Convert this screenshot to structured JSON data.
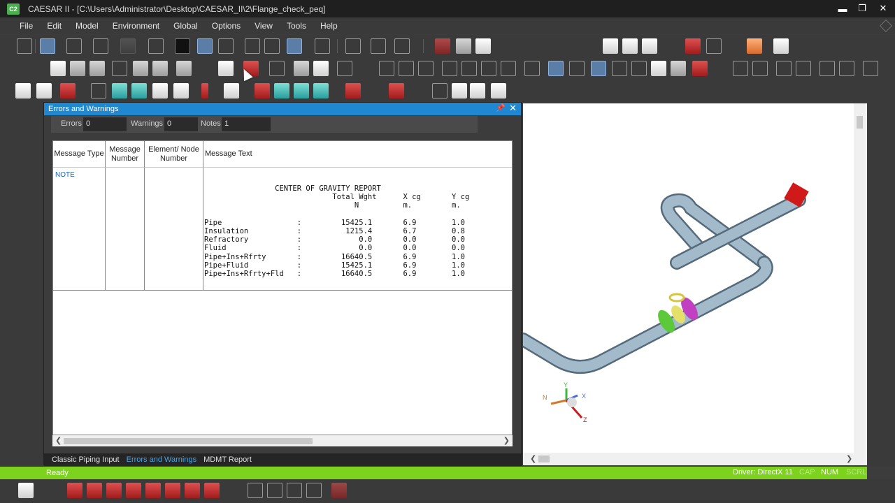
{
  "window": {
    "app_badge": "C2",
    "title": "CAESAR II - [C:\\Users\\Administrator\\Desktop\\CAESAR_II\\2\\Flange_check_peq]",
    "minimize": "▬",
    "maximize": "❐",
    "close": "✕"
  },
  "menu": [
    "File",
    "Edit",
    "Model",
    "Environment",
    "Global",
    "Options",
    "View",
    "Tools",
    "Help"
  ],
  "panel": {
    "title": "Errors and Warnings",
    "pin": "📌",
    "close": "✕",
    "counts": {
      "errors_label": "Errors",
      "errors_value": "0",
      "warnings_label": "Warnings",
      "warnings_value": "0",
      "notes_label": "Notes",
      "notes_value": "1"
    },
    "columns": [
      "Message Type",
      "Message Number",
      "Element/ Node Number",
      "Message Text"
    ],
    "row": {
      "type": "NOTE"
    },
    "report_lines": [
      "                CENTER OF GRAVITY REPORT",
      "                             Total Wght      X cg       Y cg",
      "                                  N          m.         m.",
      "",
      "Pipe                 :         15425.1       6.9        1.0",
      "Insulation           :          1215.4       6.7        0.8",
      "Refractory           :             0.0       0.0        0.0",
      "Fluid                :             0.0       0.0        0.0",
      "Pipe+Ins+Rfrty       :         16640.5       6.9        1.0",
      "Pipe+Fluid           :         15425.1       6.9        1.0",
      "Pipe+Ins+Rfrty+Fld   :         16640.5       6.9        1.0"
    ],
    "tabs": [
      "Classic Piping Input",
      "Errors and Warnings",
      "MDMT Report"
    ],
    "active_tab": "Errors and Warnings"
  },
  "axes": {
    "y": "Y",
    "x": "X",
    "n": "N",
    "z": "Z"
  },
  "status": {
    "ready": "Ready",
    "driver": "Driver: DirectX 11",
    "cap": "CAP",
    "num": "NUM",
    "scrl": "SCRL"
  },
  "colors": {
    "panel_header": "#1f88d1",
    "status_bar": "#7cd21c",
    "pipe": "#9db4c8",
    "flange_green": "#5cc93a",
    "valve_magenta": "#c13fc1",
    "anchor_red": "#d01a1a"
  }
}
